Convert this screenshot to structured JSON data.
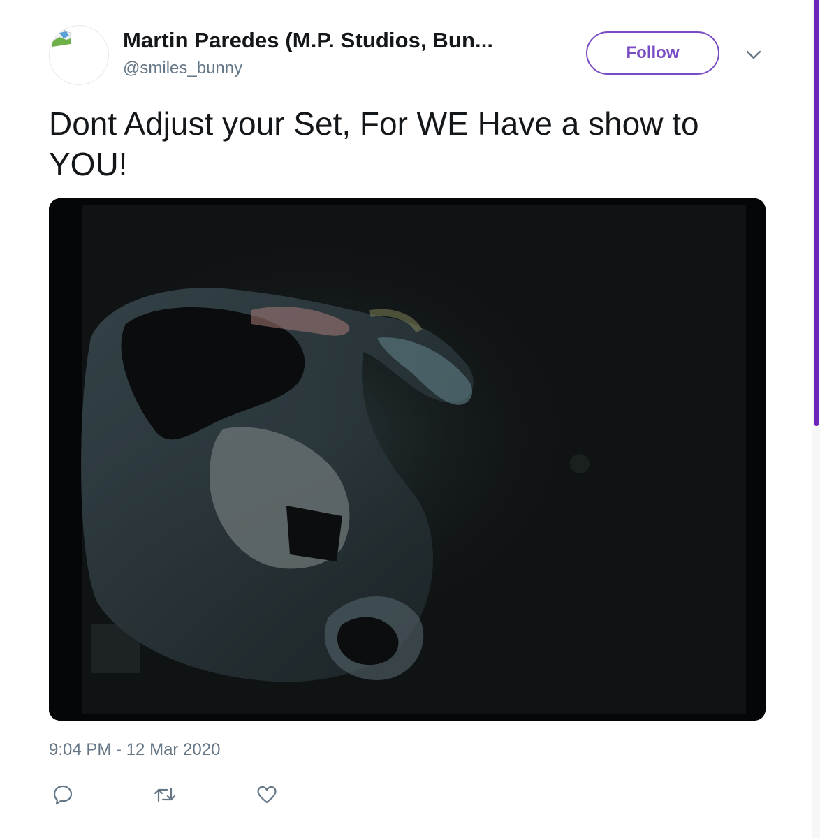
{
  "tweet": {
    "author": {
      "display_name": "Martin Paredes (M.P. Studios, Bun...",
      "handle": "@smiles_bunny",
      "avatar_icon": "broken-image-icon"
    },
    "follow_label": "Follow",
    "more_icon": "chevron-down-icon",
    "text": "Dont Adjust your Set, For WE Have a show to YOU!",
    "timestamp": "9:04 PM - 12 Mar 2020",
    "actions": [
      {
        "name": "reply",
        "icon": "reply-icon"
      },
      {
        "name": "retweet",
        "icon": "retweet-icon"
      },
      {
        "name": "like",
        "icon": "heart-icon"
      }
    ]
  },
  "colors": {
    "accent": "#794bc4",
    "text_primary": "#14171a",
    "text_secondary": "#657786",
    "scrollbar_thumb": "#6a27b8",
    "media_background": "#050607"
  }
}
